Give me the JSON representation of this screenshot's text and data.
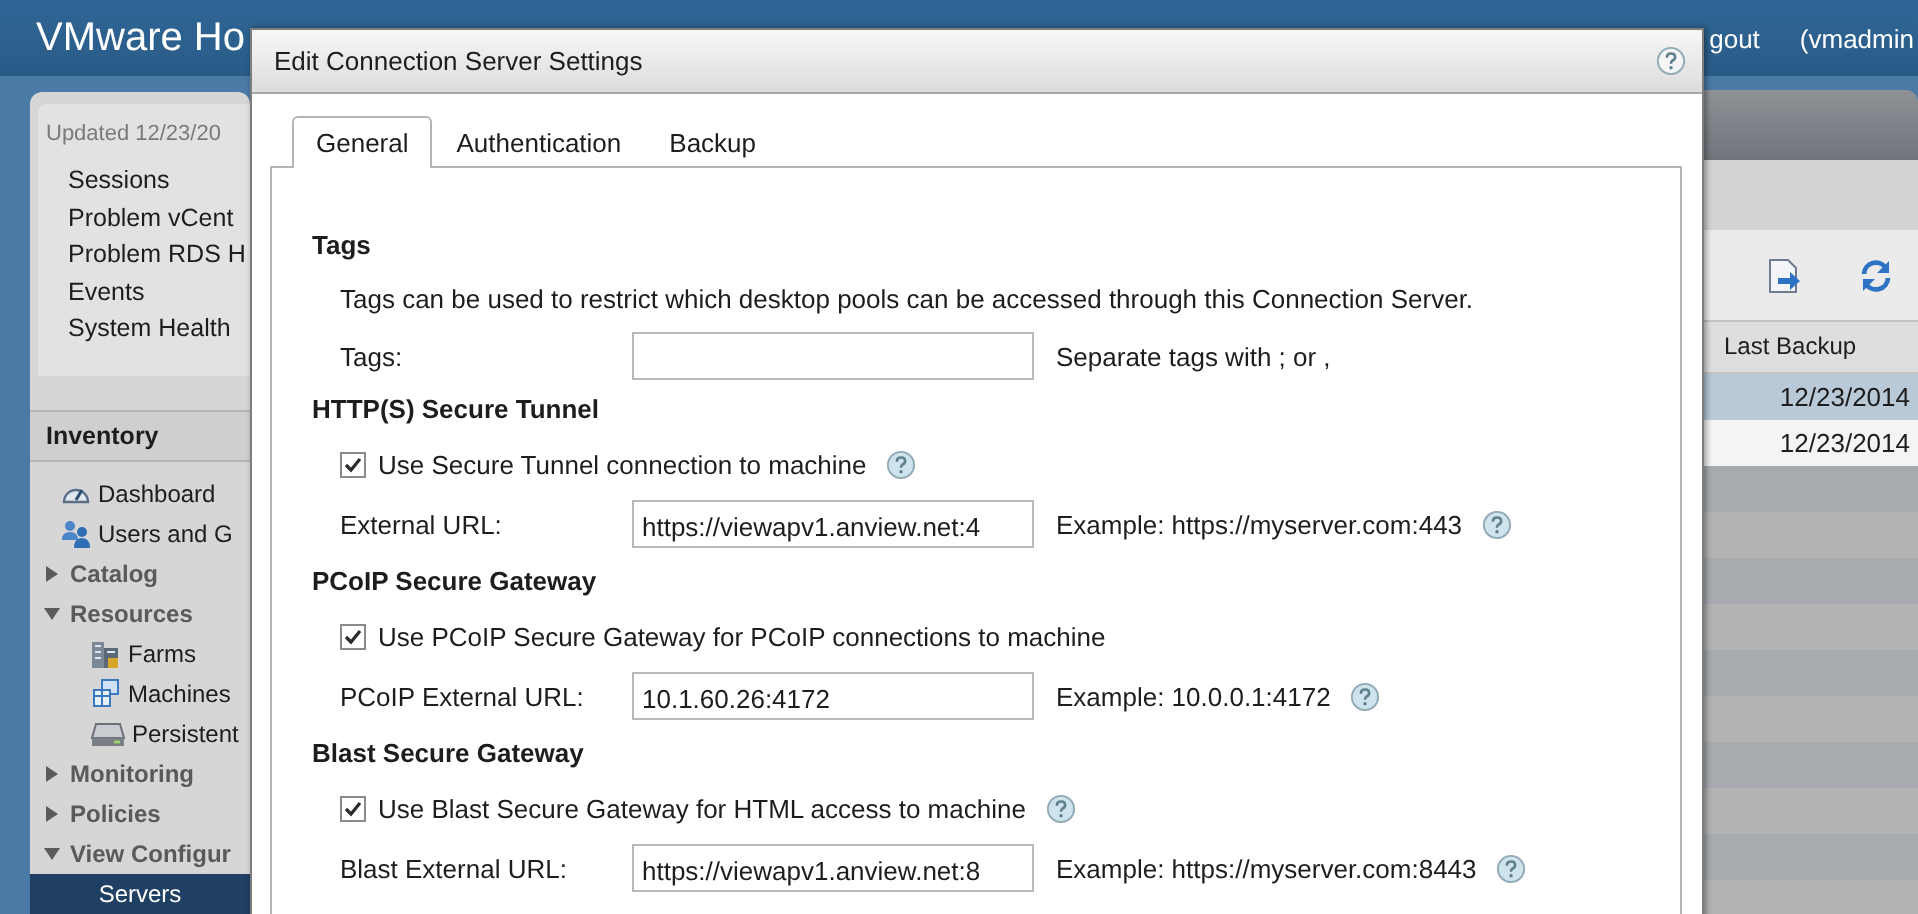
{
  "app": {
    "title": "VMware Ho",
    "header_links": [
      "gout",
      "(vmadmin"
    ]
  },
  "sidebar": {
    "updated": "Updated 12/23/20",
    "links": [
      "Sessions",
      "Problem vCent",
      "Problem RDS H",
      "Events",
      "System Health"
    ],
    "inventory": {
      "title": "Inventory",
      "items": [
        {
          "label": "Dashboard",
          "kind": "dashboard",
          "selected": false
        },
        {
          "label": "Users and G",
          "kind": "users",
          "selected": false
        },
        {
          "label": "Catalog",
          "kind": "group",
          "expanded": false,
          "selected": false
        },
        {
          "label": "Resources",
          "kind": "group",
          "expanded": true,
          "selected": false,
          "children": [
            {
              "label": "Farms",
              "kind": "farms",
              "selected": false
            },
            {
              "label": "Machines",
              "kind": "machines",
              "selected": false
            },
            {
              "label": "Persistent",
              "kind": "datastore",
              "selected": false
            }
          ]
        },
        {
          "label": "Monitoring",
          "kind": "group",
          "expanded": false,
          "selected": false
        },
        {
          "label": "Policies",
          "kind": "group",
          "expanded": false,
          "selected": false
        },
        {
          "label": "View Configur",
          "kind": "group",
          "expanded": true,
          "selected": false,
          "children": [
            {
              "label": "Servers",
              "kind": "page",
              "selected": true
            }
          ]
        }
      ]
    }
  },
  "main": {
    "table": {
      "columns": [
        "Last Backup"
      ],
      "rows": [
        {
          "cells": [
            "12/23/2014"
          ],
          "selected": true
        },
        {
          "cells": [
            "12/23/2014"
          ],
          "selected": false
        }
      ]
    }
  },
  "dialog": {
    "title": "Edit Connection Server Settings",
    "tabs": [
      {
        "label": "General",
        "selected": true
      },
      {
        "label": "Authentication",
        "selected": false
      },
      {
        "label": "Backup",
        "selected": false
      }
    ],
    "sections": [
      {
        "title": "Tags",
        "description": "Tags can be used to restrict which desktop pools can be accessed through this Connection Server.",
        "field": {
          "label": "Tags:",
          "hint": "Separate tags with ; or ,",
          "help": false
        }
      },
      {
        "title": "HTTP(S) Secure Tunnel",
        "checkbox": {
          "label": "Use Secure Tunnel connection to machine",
          "checked": true,
          "help": true
        },
        "field": {
          "label": "External URL:",
          "value": "https://viewapv1.anview.net:4",
          "hint": "Example: https://myserver.com:443",
          "help": true
        }
      },
      {
        "title": "PCoIP Secure Gateway",
        "checkbox": {
          "label": "Use PCoIP Secure Gateway for PCoIP connections to machine",
          "checked": true,
          "help": false
        },
        "field": {
          "label": "PCoIP External URL:",
          "value": "10.1.60.26:4172",
          "hint": "Example: 10.0.0.1:4172",
          "help": true
        }
      },
      {
        "title": "Blast Secure Gateway",
        "checkbox": {
          "label": "Use Blast Secure Gateway for HTML access to machine",
          "checked": true,
          "help": true
        },
        "field": {
          "label": "Blast External URL:",
          "value": "https://viewapv1.anview.net:8",
          "hint": "Example: https://myserver.com:8443",
          "help": true
        }
      }
    ]
  }
}
